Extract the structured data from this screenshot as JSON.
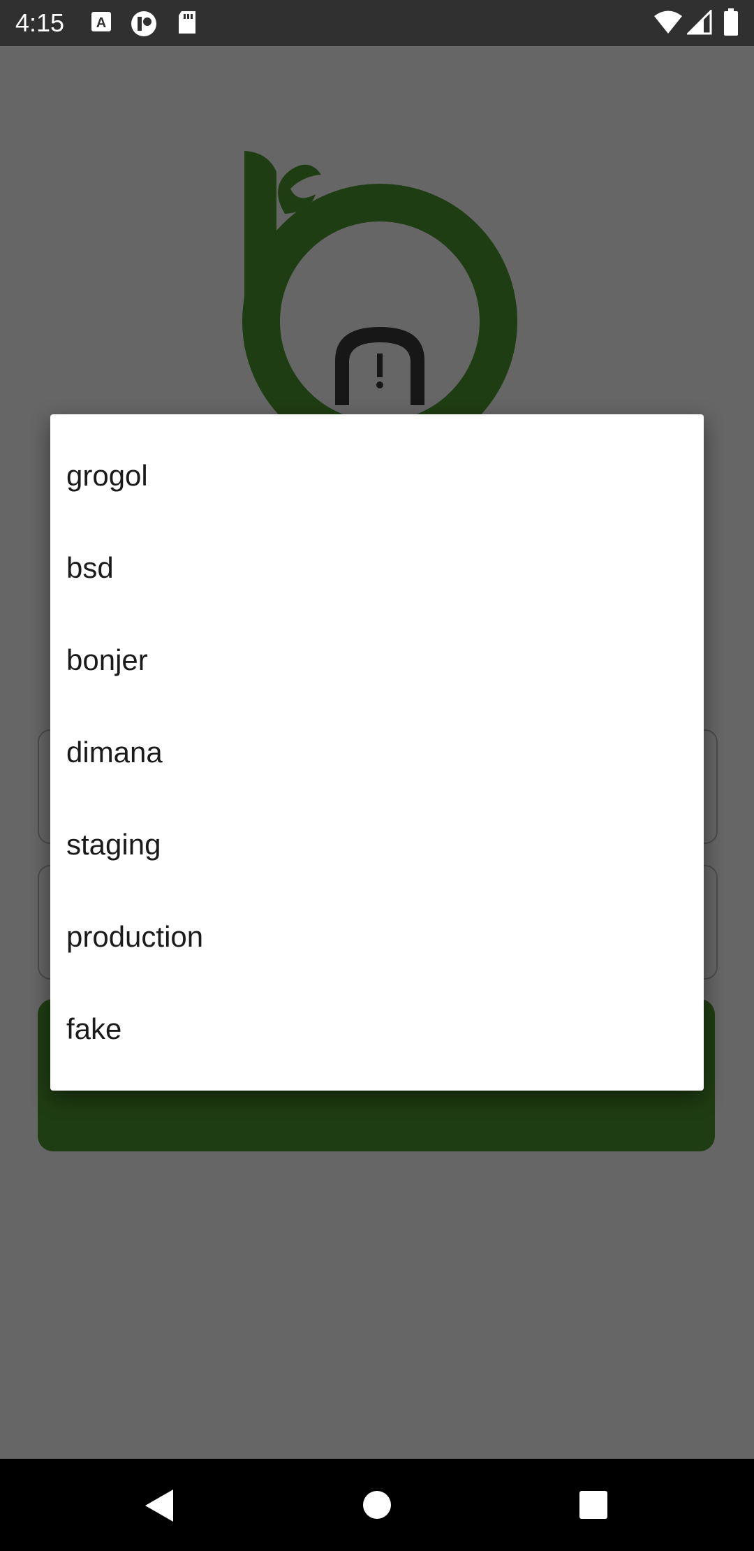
{
  "status_bar": {
    "time": "4:15",
    "left_icons": [
      "keyboard-a-icon",
      "notification-app-icon",
      "sd-card-icon"
    ],
    "right_icons": [
      "wifi-icon",
      "signal-icon",
      "battery-icon"
    ]
  },
  "dialog": {
    "options": [
      "grogol",
      "bsd",
      "bonjer",
      "dimana",
      "staging",
      "production",
      "fake"
    ]
  },
  "colors": {
    "brand_green": "#4f9a2f",
    "logo_dark": "#3a3a3a",
    "scrim": "rgba(0,0,0,0.6)"
  },
  "nav_bar": {
    "buttons": [
      "back-icon",
      "home-icon",
      "recents-icon"
    ]
  }
}
